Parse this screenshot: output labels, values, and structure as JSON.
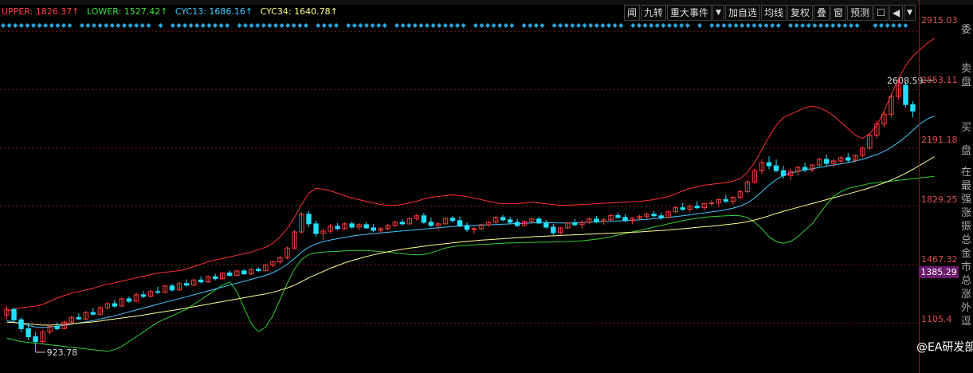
{
  "indicator_legend": [
    {
      "label": "UPPER: 1826.37↑",
      "color": "#ff4040"
    },
    {
      "label": "LOWER: 1527.42↑",
      "color": "#40e040"
    },
    {
      "label": "CYC13: 1686.16↑",
      "color": "#40d0ff"
    },
    {
      "label": "CYC34: 1640.78↑",
      "color": "#ffff80"
    }
  ],
  "toolbar": {
    "btn1": "闻",
    "btn2": "九转",
    "btn3": "重大事件",
    "btn4": "▼",
    "btn5": "加自选",
    "btn6": "均线",
    "btn7": "复权",
    "btn8": "叠",
    "btn9": "窗",
    "btn10": "预测",
    "btn11": "☐",
    "btn12": "◀",
    "btn13": "▼"
  },
  "side_panel": {
    "weibi": "委",
    "mai": "卖",
    "pan": "盘",
    "mai2": "买",
    "pan2": "盘",
    "chars": [
      "在",
      "最",
      "强",
      "涨",
      "振",
      "总",
      "金",
      "市",
      "总",
      "涨",
      "外",
      "逗"
    ]
  },
  "current_price_label": "1385.29",
  "watermark": "@EA研发部",
  "colors": {
    "up": "#ff3c3c",
    "down": "#22e0ff",
    "upper": "#ff3030",
    "lower": "#30d030",
    "cyc13": "#40c8ff",
    "cyc34": "#ffff90",
    "grid": "#7a1a1a"
  },
  "chart_data": {
    "type": "candlestick",
    "y_ticks": [
      2915.03,
      2553.11,
      2191.18,
      1829.25,
      1467.32,
      1105.4
    ],
    "ylim": [
      795,
      2980
    ],
    "annotations": [
      {
        "text": "2608.59",
        "value": 2608.59,
        "index": 129
      },
      {
        "text": "923.78",
        "value": 923.78,
        "index": 4
      }
    ],
    "candles": [
      [
        1155,
        1210,
        1130,
        1190
      ],
      [
        1190,
        1200,
        1110,
        1125
      ],
      [
        1125,
        1140,
        1050,
        1070
      ],
      [
        1070,
        1100,
        1000,
        1020
      ],
      [
        1020,
        1050,
        923.78,
        990
      ],
      [
        990,
        1060,
        980,
        1050
      ],
      [
        1050,
        1095,
        1035,
        1085
      ],
      [
        1085,
        1110,
        1060,
        1070
      ],
      [
        1070,
        1120,
        1065,
        1110
      ],
      [
        1110,
        1150,
        1100,
        1140
      ],
      [
        1140,
        1165,
        1125,
        1130
      ],
      [
        1130,
        1180,
        1120,
        1170
      ],
      [
        1170,
        1200,
        1150,
        1160
      ],
      [
        1160,
        1210,
        1150,
        1200
      ],
      [
        1200,
        1235,
        1185,
        1225
      ],
      [
        1225,
        1250,
        1200,
        1210
      ],
      [
        1210,
        1260,
        1205,
        1255
      ],
      [
        1255,
        1270,
        1230,
        1240
      ],
      [
        1240,
        1290,
        1235,
        1280
      ],
      [
        1280,
        1305,
        1260,
        1270
      ],
      [
        1270,
        1310,
        1265,
        1300
      ],
      [
        1300,
        1330,
        1285,
        1295
      ],
      [
        1295,
        1340,
        1290,
        1335
      ],
      [
        1335,
        1350,
        1300,
        1310
      ],
      [
        1310,
        1360,
        1305,
        1350
      ],
      [
        1350,
        1375,
        1330,
        1340
      ],
      [
        1340,
        1380,
        1335,
        1372
      ],
      [
        1372,
        1395,
        1350,
        1360
      ],
      [
        1360,
        1400,
        1355,
        1392
      ],
      [
        1392,
        1410,
        1370,
        1380
      ],
      [
        1380,
        1420,
        1375,
        1415
      ],
      [
        1415,
        1430,
        1395,
        1400
      ],
      [
        1400,
        1435,
        1395,
        1428
      ],
      [
        1428,
        1440,
        1405,
        1410
      ],
      [
        1410,
        1445,
        1405,
        1438
      ],
      [
        1438,
        1450,
        1420,
        1430
      ],
      [
        1430,
        1470,
        1425,
        1465
      ],
      [
        1465,
        1490,
        1450,
        1485
      ],
      [
        1485,
        1520,
        1470,
        1510
      ],
      [
        1510,
        1580,
        1500,
        1570
      ],
      [
        1570,
        1680,
        1560,
        1670
      ],
      [
        1670,
        1790,
        1660,
        1780
      ],
      [
        1780,
        1800,
        1700,
        1720
      ],
      [
        1720,
        1740,
        1640,
        1660
      ],
      [
        1660,
        1690,
        1620,
        1675
      ],
      [
        1675,
        1720,
        1660,
        1705
      ],
      [
        1705,
        1725,
        1680,
        1690
      ],
      [
        1690,
        1730,
        1685,
        1720
      ],
      [
        1720,
        1735,
        1690,
        1700
      ],
      [
        1700,
        1725,
        1680,
        1715
      ],
      [
        1715,
        1730,
        1690,
        1695
      ],
      [
        1695,
        1720,
        1670,
        1680
      ],
      [
        1680,
        1700,
        1660,
        1690
      ],
      [
        1690,
        1720,
        1680,
        1710
      ],
      [
        1710,
        1740,
        1700,
        1730
      ],
      [
        1730,
        1750,
        1710,
        1720
      ],
      [
        1720,
        1760,
        1715,
        1752
      ],
      [
        1752,
        1780,
        1740,
        1770
      ],
      [
        1770,
        1790,
        1720,
        1730
      ],
      [
        1730,
        1760,
        1700,
        1710
      ],
      [
        1710,
        1730,
        1680,
        1720
      ],
      [
        1720,
        1760,
        1715,
        1755
      ],
      [
        1755,
        1770,
        1730,
        1740
      ],
      [
        1740,
        1765,
        1700,
        1710
      ],
      [
        1710,
        1730,
        1670,
        1685
      ],
      [
        1685,
        1700,
        1660,
        1690
      ],
      [
        1690,
        1720,
        1680,
        1715
      ],
      [
        1715,
        1740,
        1700,
        1730
      ],
      [
        1730,
        1770,
        1720,
        1760
      ],
      [
        1760,
        1775,
        1735,
        1745
      ],
      [
        1745,
        1765,
        1720,
        1730
      ],
      [
        1730,
        1750,
        1700,
        1710
      ],
      [
        1710,
        1740,
        1705,
        1735
      ],
      [
        1735,
        1760,
        1720,
        1750
      ],
      [
        1750,
        1765,
        1720,
        1725
      ],
      [
        1725,
        1745,
        1690,
        1700
      ],
      [
        1700,
        1720,
        1650,
        1665
      ],
      [
        1665,
        1700,
        1655,
        1695
      ],
      [
        1695,
        1730,
        1690,
        1725
      ],
      [
        1725,
        1750,
        1705,
        1715
      ],
      [
        1715,
        1740,
        1690,
        1730
      ],
      [
        1730,
        1760,
        1720,
        1750
      ],
      [
        1750,
        1770,
        1725,
        1735
      ],
      [
        1735,
        1755,
        1715,
        1745
      ],
      [
        1745,
        1780,
        1740,
        1772
      ],
      [
        1772,
        1790,
        1750,
        1760
      ],
      [
        1760,
        1780,
        1730,
        1740
      ],
      [
        1740,
        1760,
        1720,
        1755
      ],
      [
        1755,
        1775,
        1740,
        1765
      ],
      [
        1765,
        1790,
        1750,
        1780
      ],
      [
        1780,
        1800,
        1760,
        1770
      ],
      [
        1770,
        1790,
        1745,
        1760
      ],
      [
        1760,
        1800,
        1755,
        1795
      ],
      [
        1795,
        1830,
        1785,
        1820
      ],
      [
        1820,
        1850,
        1800,
        1810
      ],
      [
        1810,
        1840,
        1795,
        1830
      ],
      [
        1830,
        1860,
        1810,
        1820
      ],
      [
        1820,
        1850,
        1805,
        1845
      ],
      [
        1845,
        1870,
        1830,
        1850
      ],
      [
        1850,
        1880,
        1825,
        1870
      ],
      [
        1870,
        1900,
        1850,
        1860
      ],
      [
        1860,
        1890,
        1840,
        1885
      ],
      [
        1885,
        1930,
        1875,
        1920
      ],
      [
        1920,
        1990,
        1910,
        1980
      ],
      [
        1980,
        2060,
        1970,
        2050
      ],
      [
        2050,
        2120,
        2030,
        2100
      ],
      [
        2100,
        2140,
        2060,
        2080
      ],
      [
        2080,
        2120,
        2040,
        2050
      ],
      [
        2050,
        2080,
        2000,
        2020
      ],
      [
        2020,
        2060,
        1990,
        2045
      ],
      [
        2045,
        2080,
        2020,
        2070
      ],
      [
        2070,
        2100,
        2040,
        2055
      ],
      [
        2055,
        2090,
        2040,
        2085
      ],
      [
        2085,
        2130,
        2070,
        2120
      ],
      [
        2120,
        2150,
        2080,
        2095
      ],
      [
        2095,
        2120,
        2070,
        2110
      ],
      [
        2110,
        2140,
        2090,
        2130
      ],
      [
        2130,
        2160,
        2100,
        2115
      ],
      [
        2115,
        2150,
        2105,
        2145
      ],
      [
        2145,
        2200,
        2130,
        2190
      ],
      [
        2190,
        2280,
        2180,
        2270
      ],
      [
        2270,
        2360,
        2250,
        2340
      ],
      [
        2340,
        2420,
        2320,
        2400
      ],
      [
        2400,
        2530,
        2380,
        2510
      ],
      [
        2510,
        2608.59,
        2490,
        2580
      ],
      [
        2580,
        2600,
        2440,
        2460
      ],
      [
        2460,
        2480,
        2380,
        2420
      ]
    ],
    "series": [
      {
        "name": "UPPER",
        "values": [
          1180,
          1190,
          1200,
          1205,
          1210,
          1220,
          1240,
          1260,
          1275,
          1290,
          1300,
          1310,
          1320,
          1335,
          1345,
          1355,
          1365,
          1375,
          1385,
          1395,
          1405,
          1415,
          1420,
          1425,
          1430,
          1440,
          1455,
          1470,
          1485,
          1495,
          1505,
          1515,
          1525,
          1535,
          1545,
          1560,
          1575,
          1600,
          1640,
          1690,
          1760,
          1840,
          1910,
          1940,
          1935,
          1925,
          1910,
          1895,
          1880,
          1870,
          1860,
          1850,
          1840,
          1835,
          1835,
          1840,
          1850,
          1860,
          1875,
          1885,
          1890,
          1895,
          1900,
          1895,
          1890,
          1880,
          1870,
          1860,
          1850,
          1845,
          1845,
          1845,
          1850,
          1855,
          1850,
          1845,
          1840,
          1835,
          1835,
          1838,
          1840,
          1842,
          1845,
          1848,
          1850,
          1852,
          1855,
          1858,
          1860,
          1865,
          1870,
          1880,
          1890,
          1905,
          1925,
          1940,
          1950,
          1960,
          1965,
          1970,
          1975,
          1985,
          2000,
          2040,
          2100,
          2180,
          2260,
          2330,
          2380,
          2400,
          2420,
          2440,
          2450,
          2440,
          2420,
          2390,
          2350,
          2310,
          2270,
          2250,
          2280,
          2330,
          2420,
          2520,
          2620,
          2700,
          2760,
          2800,
          2840,
          2870
        ]
      },
      {
        "name": "LOWER",
        "values": [
          1010,
          1000,
          990,
          985,
          980,
          975,
          970,
          965,
          960,
          955,
          950,
          945,
          940,
          935,
          930,
          940,
          960,
          990,
          1020,
          1050,
          1080,
          1110,
          1130,
          1150,
          1170,
          1190,
          1220,
          1250,
          1280,
          1310,
          1340,
          1360,
          1300,
          1200,
          1100,
          1050,
          1080,
          1150,
          1250,
          1350,
          1440,
          1500,
          1530,
          1540,
          1545,
          1548,
          1550,
          1553,
          1555,
          1556,
          1555,
          1552,
          1548,
          1545,
          1540,
          1535,
          1530,
          1528,
          1530,
          1540,
          1555,
          1570,
          1580,
          1585,
          1588,
          1590,
          1592,
          1595,
          1597,
          1600,
          1602,
          1603,
          1604,
          1605,
          1606,
          1607,
          1608,
          1609,
          1610,
          1612,
          1615,
          1620,
          1625,
          1632,
          1640,
          1650,
          1660,
          1670,
          1680,
          1690,
          1700,
          1710,
          1720,
          1730,
          1740,
          1748,
          1755,
          1760,
          1765,
          1768,
          1770,
          1772,
          1770,
          1760,
          1730,
          1690,
          1640,
          1610,
          1600,
          1610,
          1640,
          1680,
          1720,
          1780,
          1840,
          1890,
          1920,
          1940,
          1950,
          1960,
          1970,
          1975,
          1980,
          1985,
          1990,
          1995,
          2000,
          2005,
          2010,
          2015
        ]
      },
      {
        "name": "CYC13",
        "values": [
          1120,
          1110,
          1100,
          1090,
          1080,
          1078,
          1080,
          1085,
          1090,
          1098,
          1105,
          1112,
          1120,
          1130,
          1140,
          1150,
          1162,
          1174,
          1186,
          1198,
          1210,
          1222,
          1234,
          1245,
          1256,
          1268,
          1280,
          1292,
          1304,
          1316,
          1328,
          1340,
          1352,
          1364,
          1376,
          1388,
          1400,
          1418,
          1440,
          1470,
          1505,
          1545,
          1575,
          1595,
          1610,
          1620,
          1628,
          1636,
          1644,
          1650,
          1655,
          1660,
          1664,
          1668,
          1672,
          1676,
          1680,
          1684,
          1688,
          1692,
          1696,
          1700,
          1704,
          1706,
          1708,
          1710,
          1712,
          1714,
          1716,
          1718,
          1720,
          1722,
          1724,
          1726,
          1728,
          1728,
          1727,
          1726,
          1726,
          1727,
          1728,
          1730,
          1732,
          1734,
          1736,
          1738,
          1740,
          1742,
          1745,
          1748,
          1752,
          1756,
          1760,
          1765,
          1770,
          1776,
          1782,
          1788,
          1794,
          1800,
          1808,
          1818,
          1830,
          1850,
          1880,
          1920,
          1960,
          1995,
          2020,
          2035,
          2045,
          2055,
          2062,
          2070,
          2078,
          2085,
          2092,
          2100,
          2110,
          2120,
          2135,
          2150,
          2170,
          2195,
          2225,
          2260,
          2300,
          2340,
          2370,
          2390
        ]
      },
      {
        "name": "CYC34",
        "values": [
          1110,
          1108,
          1105,
          1100,
          1095,
          1092,
          1092,
          1094,
          1096,
          1100,
          1104,
          1108,
          1112,
          1118,
          1124,
          1130,
          1136,
          1142,
          1148,
          1155,
          1162,
          1169,
          1176,
          1183,
          1190,
          1198,
          1206,
          1214,
          1222,
          1230,
          1238,
          1246,
          1254,
          1262,
          1270,
          1278,
          1286,
          1296,
          1308,
          1322,
          1340,
          1362,
          1385,
          1405,
          1425,
          1445,
          1462,
          1478,
          1492,
          1505,
          1517,
          1528,
          1538,
          1547,
          1555,
          1562,
          1569,
          1575,
          1581,
          1587,
          1592,
          1597,
          1602,
          1607,
          1611,
          1615,
          1619,
          1622,
          1625,
          1628,
          1631,
          1634,
          1637,
          1640,
          1642,
          1644,
          1646,
          1648,
          1650,
          1652,
          1654,
          1656,
          1658,
          1660,
          1662,
          1664,
          1666,
          1668,
          1670,
          1673,
          1676,
          1679,
          1682,
          1686,
          1690,
          1694,
          1698,
          1702,
          1706,
          1710,
          1715,
          1720,
          1726,
          1734,
          1744,
          1756,
          1770,
          1784,
          1798,
          1810,
          1822,
          1834,
          1846,
          1858,
          1870,
          1882,
          1894,
          1906,
          1918,
          1930,
          1944,
          1958,
          1974,
          1992,
          2012,
          2034,
          2058,
          2084,
          2110,
          2136
        ]
      }
    ]
  }
}
